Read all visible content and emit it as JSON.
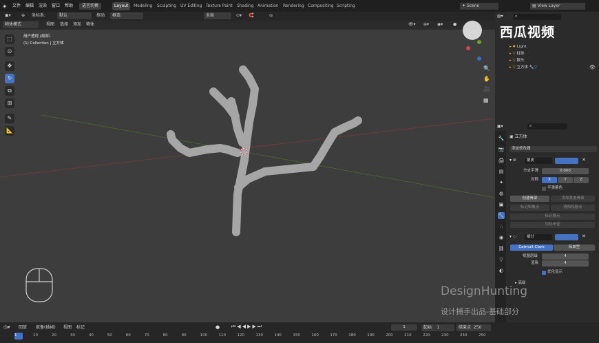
{
  "topbar": {
    "menus": [
      "文件",
      "编辑",
      "渲染",
      "窗口",
      "帮助"
    ],
    "lang_toggle": "语言切换",
    "workspaces": [
      "Layout",
      "Modeling",
      "Sculpting",
      "UV Editing",
      "Texture Paint",
      "Shading",
      "Animation",
      "Rendering",
      "Compositing",
      "Scripting"
    ],
    "active_workspace": "Layout",
    "scene": "Scene",
    "view_layer": "View Layer"
  },
  "viewport_header": {
    "coord_label": "坐标系:",
    "coord_value": "默认",
    "drag_label": "拖动",
    "drag_value": "框选",
    "transform_pivot": "全局",
    "mode": "物体模式",
    "menus": [
      "视图",
      "选择",
      "添加",
      "物体"
    ]
  },
  "viewport": {
    "view_name": "用户透视 (局部)",
    "collection_info": "(1) Collection | 立方体"
  },
  "outliner": {
    "items": [
      {
        "name": "Light",
        "color": "#e0a040"
      },
      {
        "name": "柱体",
        "color": "#e0a040"
      },
      {
        "name": "猴头",
        "color": "#e0a040"
      },
      {
        "name": "立方体",
        "color": "#e0a040"
      }
    ]
  },
  "properties": {
    "object_name": "立方体",
    "add_modifier": "添加修改器",
    "skin": {
      "name": "蒙皮",
      "branch_smooth_label": "分支平滑",
      "branch_smooth_value": "0.000",
      "symmetry_label": "对称",
      "axes": [
        "X",
        "Y",
        "Z"
      ],
      "smooth_shading": "平滑着色",
      "create_armature": "创建骨架",
      "mark_loose": "添加紧皮骨架",
      "mark_root": "标记松散点",
      "clear_loose": "清除松散点",
      "mark_root2": "标记根点",
      "equalize_radii": "均化半径"
    },
    "subsurf": {
      "name": "细分",
      "types": [
        "Catmull-Clark",
        "简单型"
      ],
      "levels_viewport_label": "视图层级",
      "levels_viewport_value": "4",
      "render_label": "渲染",
      "render_value": "4",
      "optimal_display": "优化显示",
      "advanced": "高级"
    }
  },
  "watermark": {
    "logo_text": "西瓜视频",
    "line1": "DesignHunting",
    "line2": "设计捕手出品-基础部分"
  },
  "timeline": {
    "menus": [
      "回放",
      "抠像(插帧)",
      "视图",
      "标记"
    ],
    "current_frame": "1",
    "start_label": "起始",
    "start_value": "1",
    "end_label": "结束点",
    "end_value": "250",
    "ticks": [
      "1",
      "10",
      "20",
      "30",
      "40",
      "50",
      "60",
      "70",
      "80",
      "90",
      "100",
      "110",
      "120",
      "130",
      "140",
      "150",
      "160",
      "170",
      "180",
      "190",
      "200",
      "210",
      "220",
      "230",
      "240",
      "250"
    ]
  }
}
